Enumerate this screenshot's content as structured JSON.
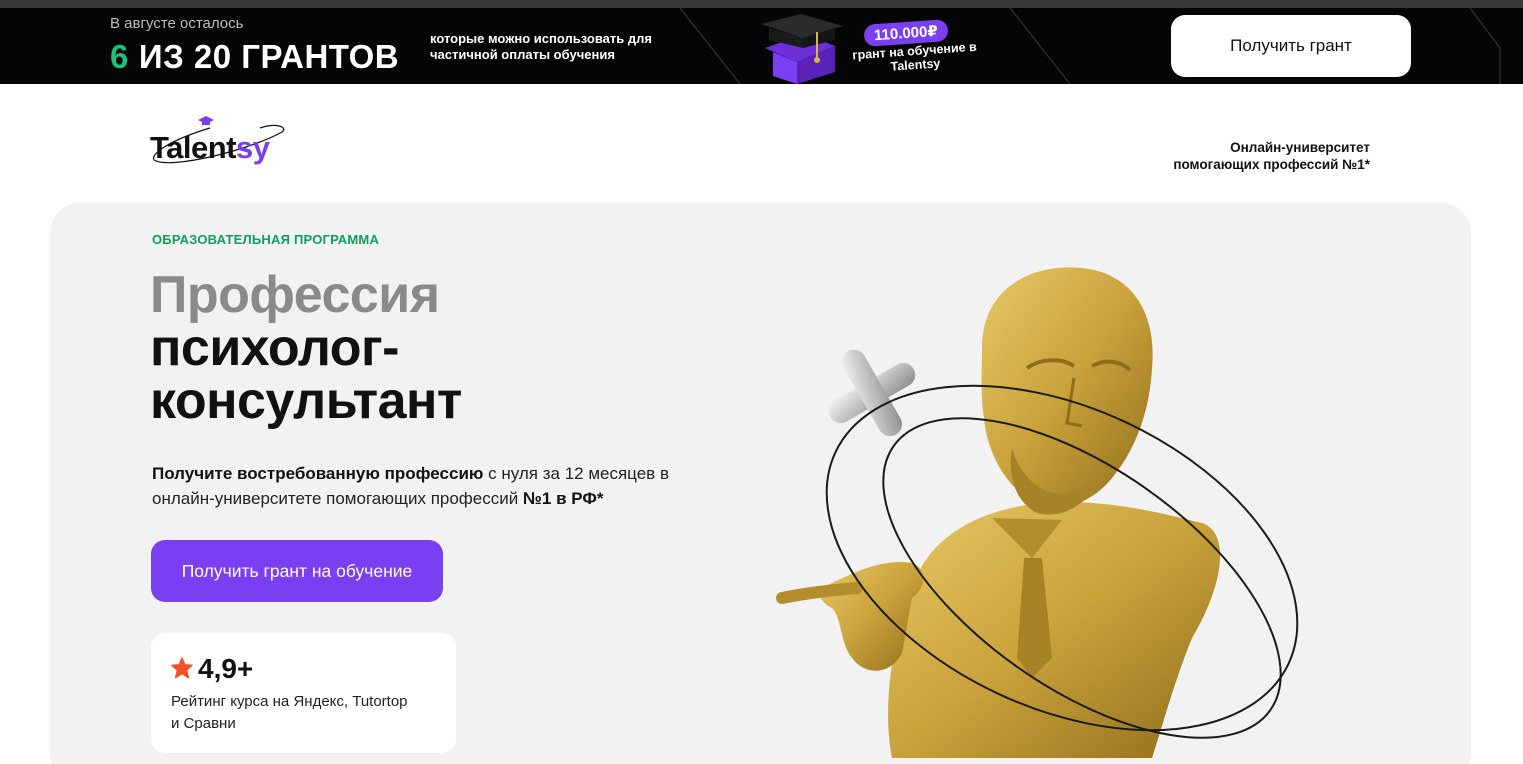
{
  "promo": {
    "remaining_label": "В августе осталось",
    "grants_number": "6",
    "grants_text": "ИЗ 20 ГРАНТОВ",
    "description": "которые можно использовать для частичной оплаты обучения",
    "grant_amount": "110.000₽",
    "grant_caption": "грант на обучение в Talentsy",
    "button_label": "Получить грант"
  },
  "header": {
    "logo_main": "Talent",
    "logo_accent": "sy",
    "tagline_line1": "Онлайн-университет",
    "tagline_line2": "помогающих профессий №1*"
  },
  "hero": {
    "eyebrow": "ОБРАЗОВАТЕЛЬНАЯ ПРОГРАММА",
    "title_line1": "Профессия",
    "title_line2": "психолог-",
    "title_line3": "консультант",
    "lead_bold": "Получите востребованную профессию",
    "lead_text1": " с нуля за 12 месяцев в онлайн-университете помогающих профессий ",
    "lead_bold2": "№1 в РФ*",
    "cta_label": "Получить грант на обучение",
    "rating_value": "4,9+",
    "rating_description": "Рейтинг курса на Яндекс, Tutortop и Сравни"
  },
  "colors": {
    "brand_purple": "#7b3ff2",
    "accent_green": "#19c37d",
    "eyebrow_green": "#0e9f61",
    "star_orange": "#f0502a",
    "bust_gold": "#c9a23a"
  },
  "icons": [
    "graduation-cap-icon",
    "star-icon",
    "bust-illustration"
  ]
}
